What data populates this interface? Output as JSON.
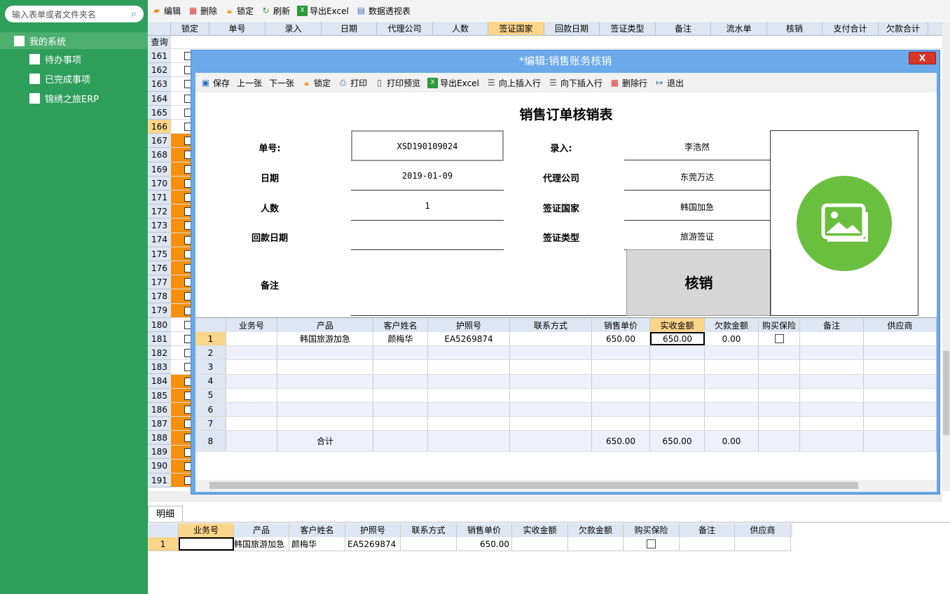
{
  "sidebar": {
    "search_placeholder": "输入表单或者文件夹名",
    "root": "我的系统",
    "items": [
      "待办事项",
      "已完成事项",
      "锦绣之旅ERP"
    ]
  },
  "toolbar": {
    "items": [
      "编辑",
      "删除",
      "锁定",
      "刷新",
      "导出Excel",
      "数据透视表"
    ]
  },
  "grid": {
    "columns": [
      "锁定",
      "单号",
      "录入",
      "日期",
      "代理公司",
      "人数",
      "签证国家",
      "回款日期",
      "签证类型",
      "备注",
      "流水单",
      "核销",
      "支付合计",
      "欠款合计"
    ],
    "filter_label": "查询",
    "rows": [
      "161",
      "162",
      "163",
      "164",
      "165",
      "166",
      "167",
      "168",
      "169",
      "170",
      "171",
      "172",
      "173",
      "174",
      "175",
      "176",
      "177",
      "178",
      "179",
      "180",
      "181",
      "182",
      "183",
      "184",
      "185",
      "186",
      "187",
      "188",
      "189",
      "190",
      "191"
    ],
    "orange": [
      167,
      168,
      169,
      170,
      171,
      172,
      173,
      174,
      175,
      176,
      177,
      178,
      179,
      184,
      185,
      186,
      187,
      188,
      189,
      190,
      191
    ],
    "selected": "166"
  },
  "dialog": {
    "title": "*编辑:销售账务核销",
    "close": "X",
    "toolbar": [
      "保存",
      "上一张",
      "下一张",
      "锁定",
      "打印",
      "打印预览",
      "导出Excel",
      "向上插入行",
      "向下插入行",
      "删除行",
      "退出"
    ],
    "form_title": "销售订单核销表",
    "labels": {
      "no": "单号:",
      "entry": "录入:",
      "date": "日期",
      "agent": "代理公司",
      "people": "人数",
      "country": "签证国家",
      "return_date": "回款日期",
      "visa_type": "签证类型",
      "remark": "备注"
    },
    "values": {
      "no": "XSD190109024",
      "entry": "李浩然",
      "date": "2019-01-09",
      "agent": "东莞万达",
      "people": "1",
      "country": "韩国加急",
      "return_date": "",
      "visa_type": "旅游签证",
      "remark": ""
    },
    "writeoff": "核销",
    "table": {
      "columns": [
        "业务号",
        "产品",
        "客户姓名",
        "护照号",
        "联系方式",
        "销售单价",
        "实收金额",
        "欠款金额",
        "购买保险",
        "备注",
        "供应商"
      ],
      "rows": [
        {
          "n": "1",
          "biz": "",
          "product": "韩国旅游加急",
          "name": "颜梅华",
          "passport": "EA5269874",
          "contact": "",
          "price": "650.00",
          "received": "650.00",
          "owed": "0.00",
          "remark": "",
          "supplier": ""
        },
        {
          "n": "2"
        },
        {
          "n": "3"
        },
        {
          "n": "4"
        },
        {
          "n": "5"
        },
        {
          "n": "6"
        },
        {
          "n": "7"
        }
      ],
      "total": {
        "n": "8",
        "label": "合计",
        "price": "650.00",
        "received": "650.00",
        "owed": "0.00"
      }
    }
  },
  "detail": {
    "tab": "明细",
    "columns": [
      "业务号",
      "产品",
      "客户姓名",
      "护照号",
      "联系方式",
      "销售单价",
      "实收金额",
      "欠款金额",
      "购买保险",
      "备注",
      "供应商"
    ],
    "row": {
      "n": "1",
      "biz": "",
      "product": "韩国旅游加急",
      "name": "颜梅华",
      "passport": "EA5269874",
      "contact": "",
      "price": "650.00",
      "received": "",
      "owed": ""
    }
  }
}
